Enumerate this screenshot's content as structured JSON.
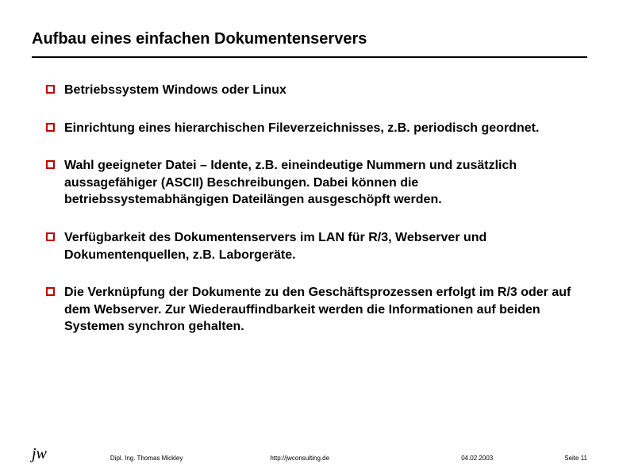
{
  "title": "Aufbau eines einfachen Dokumentenservers",
  "bullets": [
    "Betriebssystem Windows oder Linux",
    "Einrichtung eines hierarchischen Fileverzeichnisses, z.B. periodisch geordnet.",
    "Wahl geeigneter Datei – Idente, z.B. eineindeutige Nummern und zusätzlich aussagefähiger (ASCII) Beschreibungen. Dabei können die betriebssystemabhängigen Dateilängen ausgeschöpft werden.",
    "Verfügbarkeit des Dokumentenservers im LAN für R/3, Webserver und Dokumentenquellen, z.B. Laborgeräte.",
    "Die Verknüpfung der Dokumente zu den Geschäftsprozessen erfolgt im R/3 oder auf dem Webserver. Zur Wiederauffindbarkeit werden die Informationen auf beiden Systemen synchron gehalten."
  ],
  "footer": {
    "logo": "jw",
    "author": "Dipl. Ing. Thomas Mickley",
    "url": "http://jwconsulting.de",
    "date": "04.02.2003",
    "page": "Seite 11"
  }
}
